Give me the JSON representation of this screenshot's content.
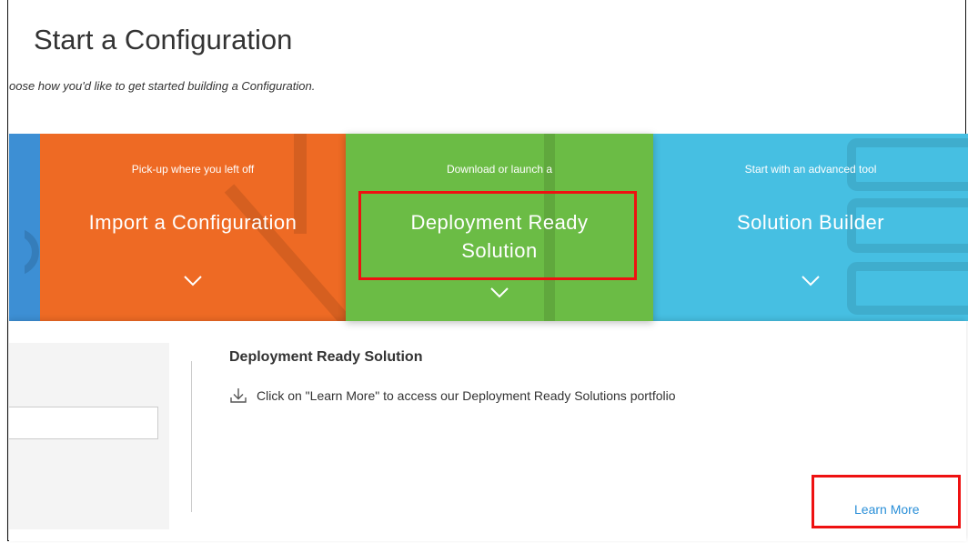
{
  "page": {
    "title": "Start a Configuration",
    "subtitle": "oose how you'd like to get started building a Configuration."
  },
  "tiles": [
    {
      "id": "import",
      "small": "Pick-up where you left off",
      "big": "Import a Configuration",
      "color": "#ee6a24",
      "icon": "chevron-down-icon"
    },
    {
      "id": "deployment",
      "small": "Download or launch a",
      "big_line1": "Deployment Ready",
      "big_line2": "Solution",
      "color": "#6bbc45",
      "icon": "chevron-down-icon"
    },
    {
      "id": "solution-builder",
      "small": "Start with an advanced tool",
      "big": "Solution Builder",
      "color": "#46bfe2",
      "icon": "chevron-down-icon"
    }
  ],
  "panel": {
    "title": "Deployment Ready Solution",
    "description": "Click on \"Learn More\" to access our Deployment Ready Solutions portfolio",
    "icon": "download-icon",
    "learn_more": "Learn More"
  },
  "colors": {
    "highlight": "#ee1111",
    "link": "#2a8fd8",
    "blue_tile": "#3d8fd4"
  }
}
